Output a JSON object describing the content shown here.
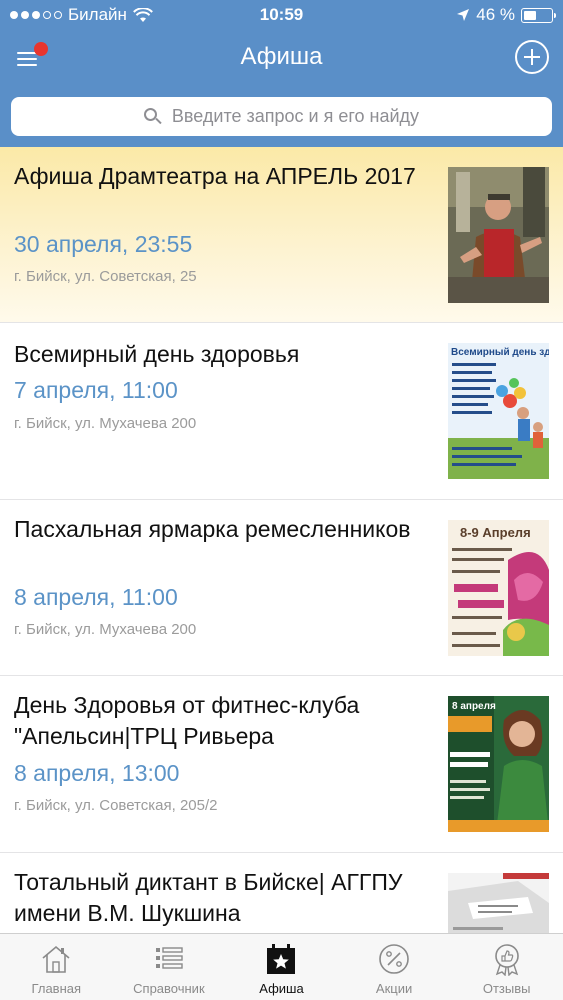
{
  "status_bar": {
    "carrier": "Билайн",
    "time": "10:59",
    "battery_text": "46 %",
    "battery_level": 0.46
  },
  "header": {
    "title": "Афиша",
    "menu_icon": "menu-icon",
    "add_icon": "plus-circle-icon"
  },
  "search": {
    "placeholder": "Введите запрос и я его найду"
  },
  "events": [
    {
      "title": "Афиша Драмтеатра на АПРЕЛЬ 2017",
      "date": "30 апреля, 23:55",
      "place": "г. Бийск, ул. Советская, 25",
      "featured": true
    },
    {
      "title": "Всемирный день здоровья",
      "date": "7 апреля, 11:00",
      "place": "г. Бийск, ул. Мухачева 200",
      "thumb_text": "Всемирный день зд"
    },
    {
      "title": "Пасхальная ярмарка ремесленников",
      "date": "8 апреля, 11:00",
      "place": "г. Бийск, ул. Мухачева 200",
      "thumb_text": "8-9 Апреля"
    },
    {
      "title": "День Здоровья от фитнес-клуба \"Апельсин|ТРЦ Ривьера",
      "date": "8 апреля, 13:00",
      "place": "г. Бийск, ул. Советская, 205/2",
      "thumb_text": "8 апреля"
    },
    {
      "title": "Тотальный диктант в Бийске| АГГПУ имени В.М. Шукшина",
      "date": "",
      "place": ""
    }
  ],
  "tabs": [
    {
      "label": "Главная",
      "icon": "home-icon",
      "active": false
    },
    {
      "label": "Справочник",
      "icon": "list-icon",
      "active": false
    },
    {
      "label": "Афиша",
      "icon": "calendar-star-icon",
      "active": true
    },
    {
      "label": "Акции",
      "icon": "percent-icon",
      "active": false
    },
    {
      "label": "Отзывы",
      "icon": "thumbs-up-badge-icon",
      "active": false
    }
  ],
  "colors": {
    "header_bg": "#5a8fc8",
    "date_text": "#5b93c7",
    "badge": "#e8352e"
  }
}
